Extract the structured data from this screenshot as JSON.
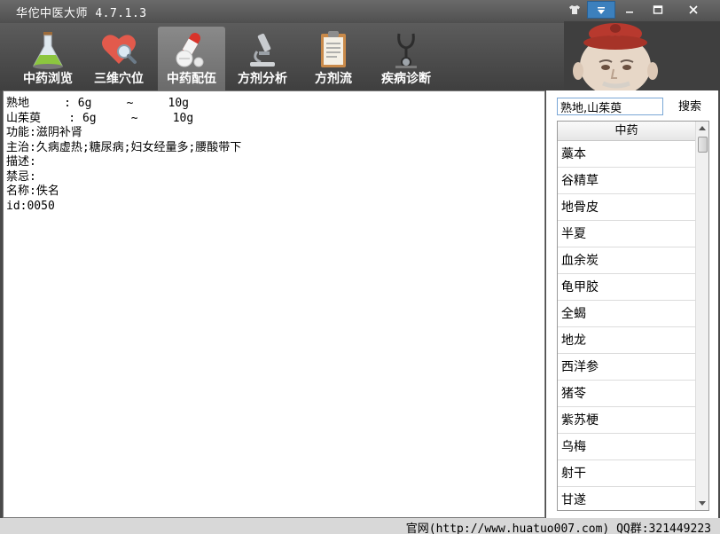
{
  "window": {
    "title": "华佗中医大师 4.7.1.3"
  },
  "toolbar": {
    "tabs": [
      {
        "label": "中药浏览",
        "icon": "flask-icon"
      },
      {
        "label": "三维穴位",
        "icon": "heart-magnifier-icon"
      },
      {
        "label": "中药配伍",
        "icon": "pills-icon"
      },
      {
        "label": "方剂分析",
        "icon": "microscope-icon"
      },
      {
        "label": "方剂流",
        "icon": "clipboard-icon"
      },
      {
        "label": "疾病诊断",
        "icon": "stethoscope-icon"
      }
    ],
    "active_index": 2
  },
  "content": {
    "lines": [
      "熟地     : 6g     ~     10g",
      "山茱萸    : 6g     ~     10g",
      "功能:滋阴补肾",
      "主治:久病虚热;糖尿病;妇女经量多;腰酸带下",
      "描述:",
      "禁忌:",
      "名称:佚名",
      "id:0050"
    ]
  },
  "search": {
    "value": "熟地,山茱萸",
    "button_label": "搜索"
  },
  "herb_list": {
    "header": "中药",
    "items": [
      "藁本",
      "谷精草",
      "地骨皮",
      "半夏",
      "血余炭",
      "龟甲胶",
      "全蝎",
      "地龙",
      "西洋参",
      "猪苓",
      "紫苏梗",
      "乌梅",
      "射干",
      "甘遂"
    ]
  },
  "status": {
    "text": "官网(http://www.huatuo007.com) QQ群:321449223"
  },
  "colors": {
    "accent": "#3c80bd",
    "chrome_dark": "#4a4a4a"
  }
}
